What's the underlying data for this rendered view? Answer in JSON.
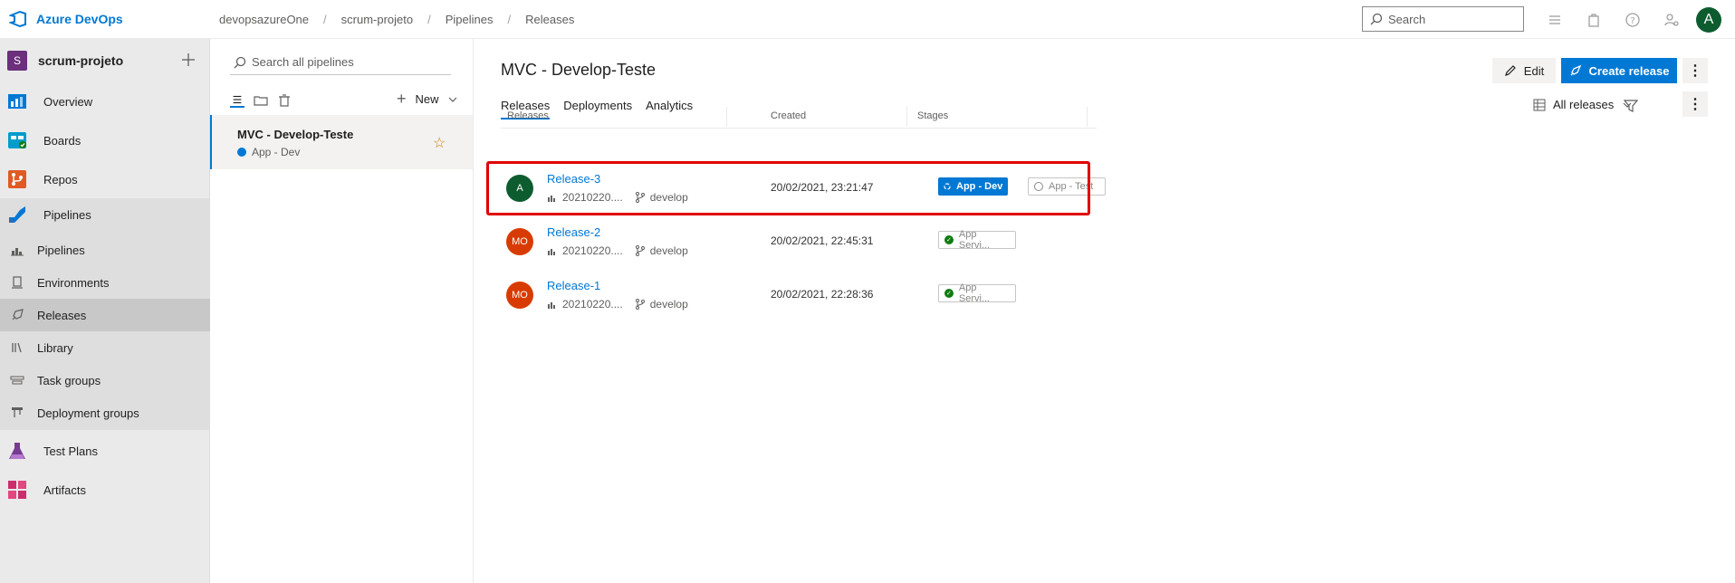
{
  "topbar": {
    "brand": "Azure DevOps",
    "breadcrumb": [
      "devopsazureOne",
      "scrum-projeto",
      "Pipelines",
      "Releases"
    ],
    "search_placeholder": "Search",
    "user_initial": "A",
    "icons": [
      "list-icon",
      "shopping-bag-icon",
      "help-icon",
      "user-settings-icon"
    ]
  },
  "sidebar": {
    "project_initial": "S",
    "project_name": "scrum-projeto",
    "items": [
      {
        "label": "Overview",
        "icon": "overview-icon"
      },
      {
        "label": "Boards",
        "icon": "boards-icon"
      },
      {
        "label": "Repos",
        "icon": "repos-icon"
      },
      {
        "label": "Pipelines",
        "icon": "pipelines-icon"
      },
      {
        "label": "Test Plans",
        "icon": "test-plans-icon"
      },
      {
        "label": "Artifacts",
        "icon": "artifacts-icon"
      }
    ],
    "sub_items": [
      {
        "label": "Pipelines",
        "icon": "pipelines-sub-icon"
      },
      {
        "label": "Environments",
        "icon": "environments-icon"
      },
      {
        "label": "Releases",
        "icon": "releases-icon"
      },
      {
        "label": "Library",
        "icon": "library-icon"
      },
      {
        "label": "Task groups",
        "icon": "task-groups-icon"
      },
      {
        "label": "Deployment groups",
        "icon": "deployment-groups-icon"
      }
    ]
  },
  "pipeline_list": {
    "search_placeholder": "Search all pipelines",
    "new_label": "New",
    "selected_pipeline": {
      "name": "MVC - Develop-Teste",
      "sub": "App - Dev"
    }
  },
  "main": {
    "title": "MVC - Develop-Teste",
    "edit_label": "Edit",
    "create_label": "Create release",
    "tabs": [
      "Releases",
      "Deployments",
      "Analytics"
    ],
    "filter_label": "All releases",
    "columns": [
      "Releases",
      "Created",
      "Stages"
    ],
    "rows": [
      {
        "avatar": "A",
        "avatar_color": "#0d5c2f",
        "name": "Release-3",
        "build": "20210220....",
        "branch": "develop",
        "created": "20/02/2021, 23:21:47",
        "stages": [
          {
            "label": "App - Dev",
            "style": "blue"
          },
          {
            "label": "App - Test",
            "style": "outline"
          }
        ]
      },
      {
        "avatar": "MO",
        "avatar_color": "#d83b01",
        "name": "Release-2",
        "build": "20210220....",
        "branch": "develop",
        "created": "20/02/2021, 22:45:31",
        "stages": [
          {
            "label": "App Servi...",
            "style": "success"
          }
        ]
      },
      {
        "avatar": "MO",
        "avatar_color": "#d83b01",
        "name": "Release-1",
        "build": "20210220....",
        "branch": "develop",
        "created": "20/02/2021, 22:28:36",
        "stages": [
          {
            "label": "App Servi...",
            "style": "success"
          }
        ]
      }
    ]
  },
  "colors": {
    "accent": "#0078d4",
    "highlight": "#e00000",
    "success": "#107c10"
  }
}
